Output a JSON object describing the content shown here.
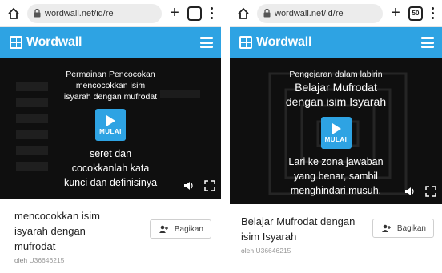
{
  "screens": [
    {
      "browser": {
        "url": "wordwall.net/id/re",
        "tab_count": ""
      },
      "header": {
        "logo_text": "Wordwall"
      },
      "game": {
        "top_lines": [
          "Permainan Pencocokan",
          "mencocokkan isim",
          "isyarah dengan mufrodat"
        ],
        "play_label": "MULAI",
        "description_lines": [
          "seret dan",
          "cocokkanlah kata",
          "kunci dan definisinya"
        ]
      },
      "info": {
        "title": "mencocokkan isim isyarah dengan mufrodat",
        "share_label": "Bagikan",
        "author_prefix": "oleh",
        "author": "U36646215"
      }
    },
    {
      "browser": {
        "url": "wordwall.net/id/re",
        "tab_count": "50"
      },
      "header": {
        "logo_text": "Wordwall"
      },
      "game": {
        "top_lines": [
          "Pengejaran dalam labirin"
        ],
        "big_lines": [
          "Belajar Mufrodat",
          "dengan isim Isyarah"
        ],
        "play_label": "MULAI",
        "description_lines": [
          "Lari ke zona jawaban",
          "yang benar, sambil",
          "menghindari musuh."
        ]
      },
      "info": {
        "title": "Belajar Mufrodat dengan isim Isyarah",
        "share_label": "Bagikan",
        "author_prefix": "oleh",
        "author": "U36646215"
      }
    }
  ],
  "colors": {
    "brand": "#2ea3e3",
    "game_bg": "#0f0f0f"
  },
  "icons": [
    "home-icon",
    "lock-icon",
    "plus-icon",
    "tabs-icon",
    "more-vert-icon",
    "hamburger-icon",
    "play-icon",
    "volume-icon",
    "fullscreen-icon",
    "share-icon"
  ]
}
